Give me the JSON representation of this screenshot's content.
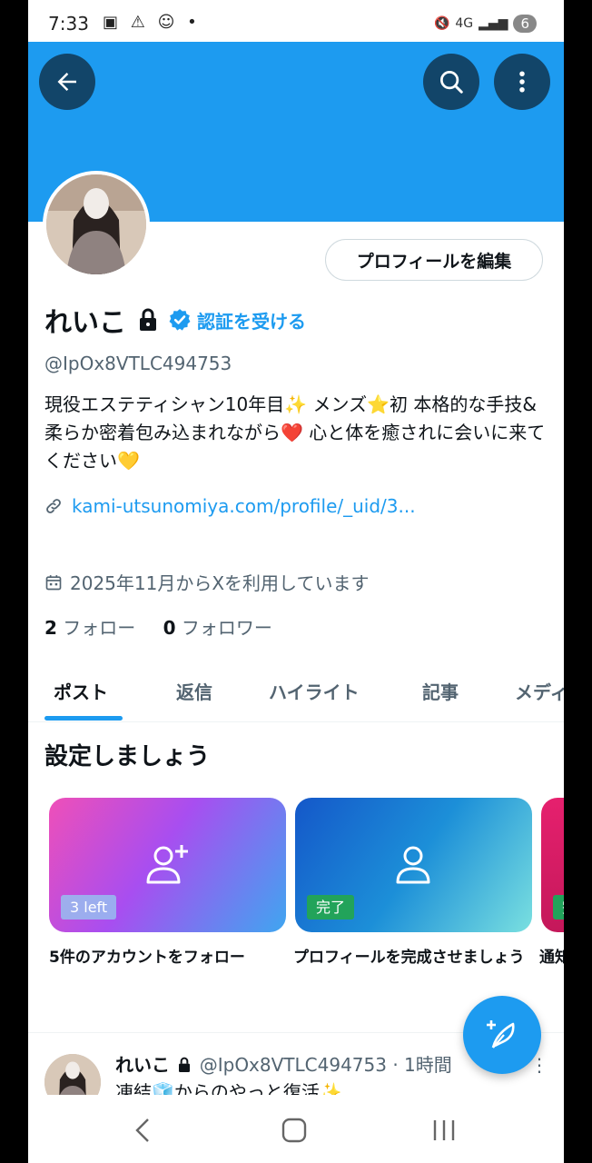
{
  "status": {
    "time": "7:33",
    "network": "4G",
    "battery": "6"
  },
  "profile": {
    "edit_label": "プロフィールを編集",
    "name": "れいこ",
    "verify_label": "認証を受ける",
    "handle": "@IpOx8VTLC494753",
    "bio": "現役エステティシャン10年目✨ メンズ⭐初 本格的な手技&柔らか密着包み込まれながら❤️ 心と体を癒されに会いに来てください💛",
    "link": "kami-utsunomiya.com/profile/_uid/3...",
    "joined": "2025年11月からXを利用しています",
    "following_count": "2",
    "following_label": "フォロー",
    "followers_count": "0",
    "followers_label": "フォロワー"
  },
  "tabs": [
    {
      "label": "ポスト",
      "active": true
    },
    {
      "label": "返信",
      "active": false
    },
    {
      "label": "ハイライト",
      "active": false
    },
    {
      "label": "記事",
      "active": false
    },
    {
      "label": "メディ",
      "active": false
    }
  ],
  "setup": {
    "title": "設定しましょう",
    "cards": [
      {
        "badge": "3 left",
        "label": "5件のアカウントをフォロー"
      },
      {
        "badge": "完了",
        "label": "プロフィールを完成させましょう"
      },
      {
        "badge": "完",
        "label": "通知"
      }
    ]
  },
  "post": {
    "name": "れいこ",
    "handle": "@IpOx8VTLC494753",
    "time": "· 1時間",
    "text": "凍結🧊からのやっと復活✨"
  },
  "colors": {
    "accent": "#1d9bf0",
    "text": "#0f1419",
    "muted": "#536471"
  }
}
